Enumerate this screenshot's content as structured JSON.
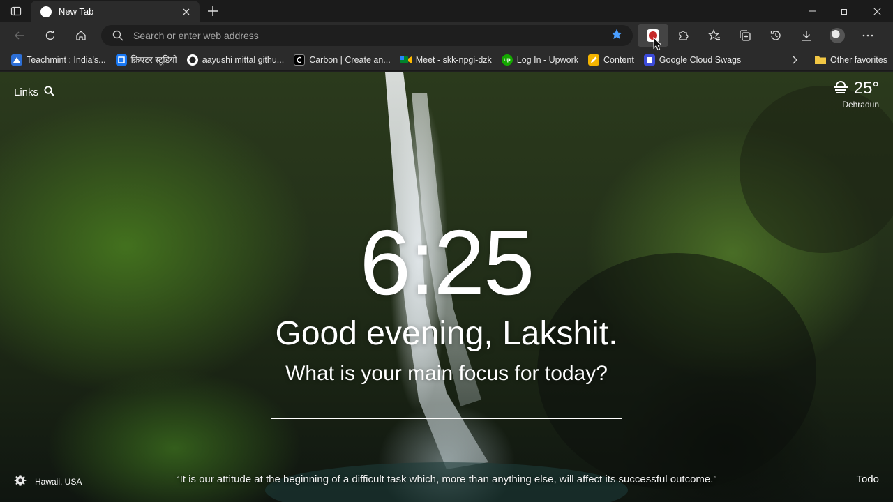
{
  "browser": {
    "tab": {
      "title": "New Tab"
    },
    "address_bar": {
      "placeholder": "Search or enter web address"
    },
    "favorites": [
      {
        "label": "Teachmint : India's...",
        "icon": "teachmint-favicon",
        "color": "#3a7bd5"
      },
      {
        "label": "क्रिएटर स्टूडियो",
        "icon": "creator-studio-favicon",
        "color": "#1877f2"
      },
      {
        "label": "aayushi mittal githu...",
        "icon": "github-favicon",
        "color": "#ffffff"
      },
      {
        "label": "Carbon | Create an...",
        "icon": "carbon-favicon",
        "color": "#000000"
      },
      {
        "label": "Meet - skk-npgi-dzk",
        "icon": "google-meet-favicon",
        "color": "#00897b"
      },
      {
        "label": "Log In - Upwork",
        "icon": "upwork-favicon",
        "color": "#14a800"
      },
      {
        "label": "Content",
        "icon": "content-favicon",
        "color": "#f4b400"
      },
      {
        "label": "Google Cloud Swags",
        "icon": "google-cloud-favicon",
        "color": "#3c4bd8"
      }
    ],
    "other_favorites": "Other favorites"
  },
  "momentum": {
    "links_label": "Links",
    "weather": {
      "temperature": "25°",
      "location": "Dehradun",
      "icon": "haze-icon"
    },
    "clock": "6:25",
    "greeting": "Good evening, Lakshit.",
    "focus_prompt": "What is your main focus for today?",
    "focus_value": "",
    "photo_location": "Hawaii, USA",
    "quote": "“It is our attitude at the beginning of a difficult task which, more than anything else, will affect its successful outcome.”",
    "todo_label": "Todo"
  },
  "colors": {
    "accent_star": "#4a9eff",
    "toolbar_bg": "#2b2b2b",
    "titlebar_bg": "#1b1b1b"
  }
}
